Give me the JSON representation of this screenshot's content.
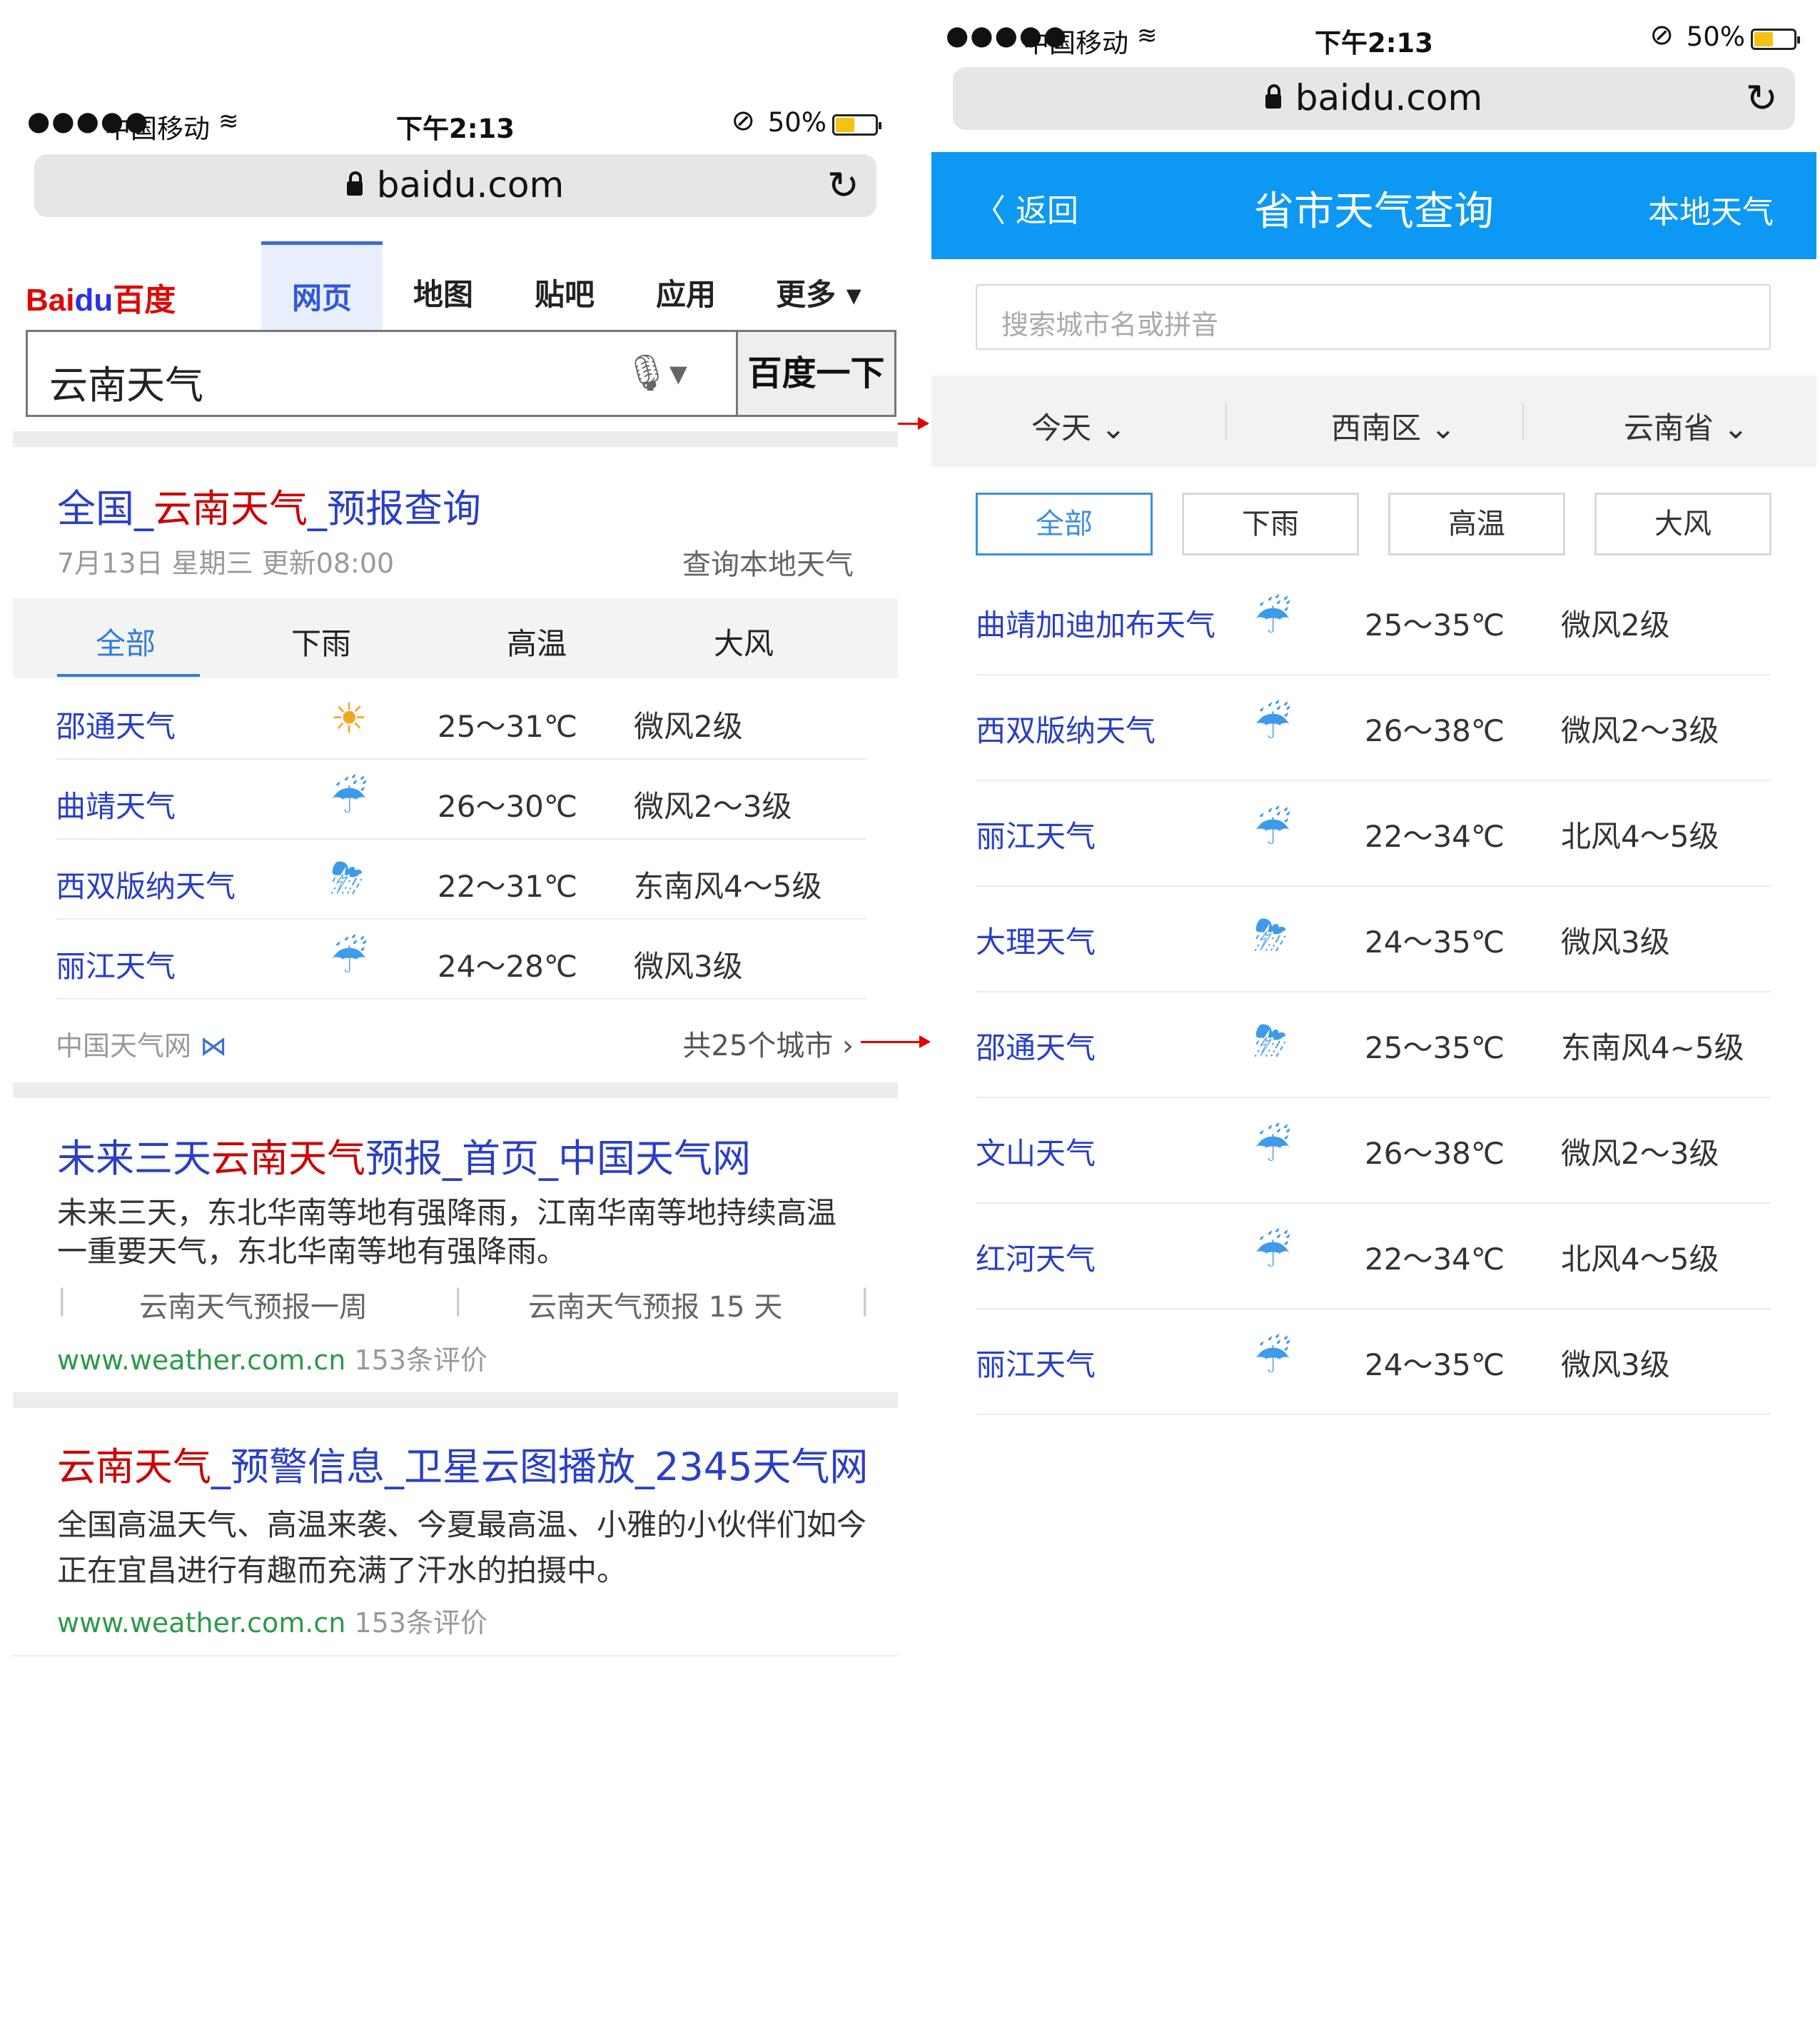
{
  "status": {
    "signal": "●●●●●",
    "carrier": "中国移动",
    "wifi": "≋",
    "time": "下午2:13",
    "lockrot": "🔒",
    "battery": "50%"
  },
  "url": {
    "domain": "baidu.com",
    "reload": "↻"
  },
  "left": {
    "logo": "Bai百度",
    "logo_mid": "du",
    "tabs": [
      "网页",
      "地图",
      "贴吧",
      "应用",
      "更多 ▾"
    ],
    "search": {
      "query": "云南天气",
      "mic": "🎙▾",
      "button": "百度一下"
    },
    "result1": {
      "t1": "全国_",
      "t2": "云南天气",
      "t3": "_预报查询",
      "date": "7月13日 星期三 更新08:00",
      "local": "查询本地天气",
      "wtabs": [
        "全部",
        "下雨",
        "高温",
        "大风"
      ],
      "rows": [
        {
          "city": "邵通天气",
          "icon": "☀",
          "temp": "25～31℃",
          "wind": "微风2级"
        },
        {
          "city": "曲靖天气",
          "icon": "☔",
          "temp": "26～30℃",
          "wind": "微风2～3级"
        },
        {
          "city": "西双版纳天气",
          "icon": "⛈",
          "temp": "22～31℃",
          "wind": "东南风4～5级"
        },
        {
          "city": "丽江天气",
          "icon": "☔",
          "temp": "24～28℃",
          "wind": "微风3级"
        }
      ],
      "source": "中国天气网",
      "source_icon": "⋈",
      "more": "共25个城市 ›"
    },
    "result2": {
      "t1": "未来三天",
      "t2": "云南天气",
      "t3": "预报_首页_中国天气网",
      "snippet1": "未来三天，东北华南等地有强降雨，江南华南等地持续高温",
      "snippet2": "一重要天气，东北华南等地有强降雨。",
      "link1": "云南天气预报一周",
      "link2": "云南天气预报 15 天",
      "url": "www.weather.com.cn",
      "reviews": "153条评价"
    },
    "result3": {
      "t1": "云南天气",
      "t2": "_预警信息_卫星云图播放_2345天气网",
      "snippet1": "全国高温天气、高温来袭、今夏最高温、小雅的小伙伴们如今",
      "snippet2": "正在宜昌进行有趣而充满了汗水的拍摄中。",
      "url": "www.weather.com.cn",
      "reviews": "153条评价"
    }
  },
  "right": {
    "back": "〈 返回",
    "title": "省市天气查询",
    "local": "本地天气",
    "search_placeholder": "搜索城市名或拼音",
    "filters": [
      "今天 ⌄",
      "西南区 ⌄",
      "云南省 ⌄"
    ],
    "chips": [
      "全部",
      "下雨",
      "高温",
      "大风"
    ],
    "rows": [
      {
        "city": "曲靖加迪加布天气",
        "icon": "☔",
        "temp": "25～35℃",
        "wind": "微风2级"
      },
      {
        "city": "西双版纳天气",
        "icon": "☔",
        "temp": "26～38℃",
        "wind": "微风2～3级"
      },
      {
        "city": "丽江天气",
        "icon": "☔",
        "temp": "22～34℃",
        "wind": "北风4～5级"
      },
      {
        "city": "大理天气",
        "icon": "⛈",
        "temp": "24～35℃",
        "wind": "微风3级"
      },
      {
        "city": "邵通天气",
        "icon": "⛈",
        "temp": "25～35℃",
        "wind": "东南风4~5级"
      },
      {
        "city": "文山天气",
        "icon": "☔",
        "temp": "26～38℃",
        "wind": "微风2～3级"
      },
      {
        "city": "红河天气",
        "icon": "☔",
        "temp": "22～34℃",
        "wind": "北风4～5级"
      },
      {
        "city": "丽江天气",
        "icon": "☔",
        "temp": "24～35℃",
        "wind": "微风3级"
      }
    ]
  },
  "colors": {
    "accent": "#0d99f3",
    "link": "#2a3fc6",
    "highlight": "#cc0000",
    "url": "#2b9a49",
    "arrow": "#e00000"
  }
}
